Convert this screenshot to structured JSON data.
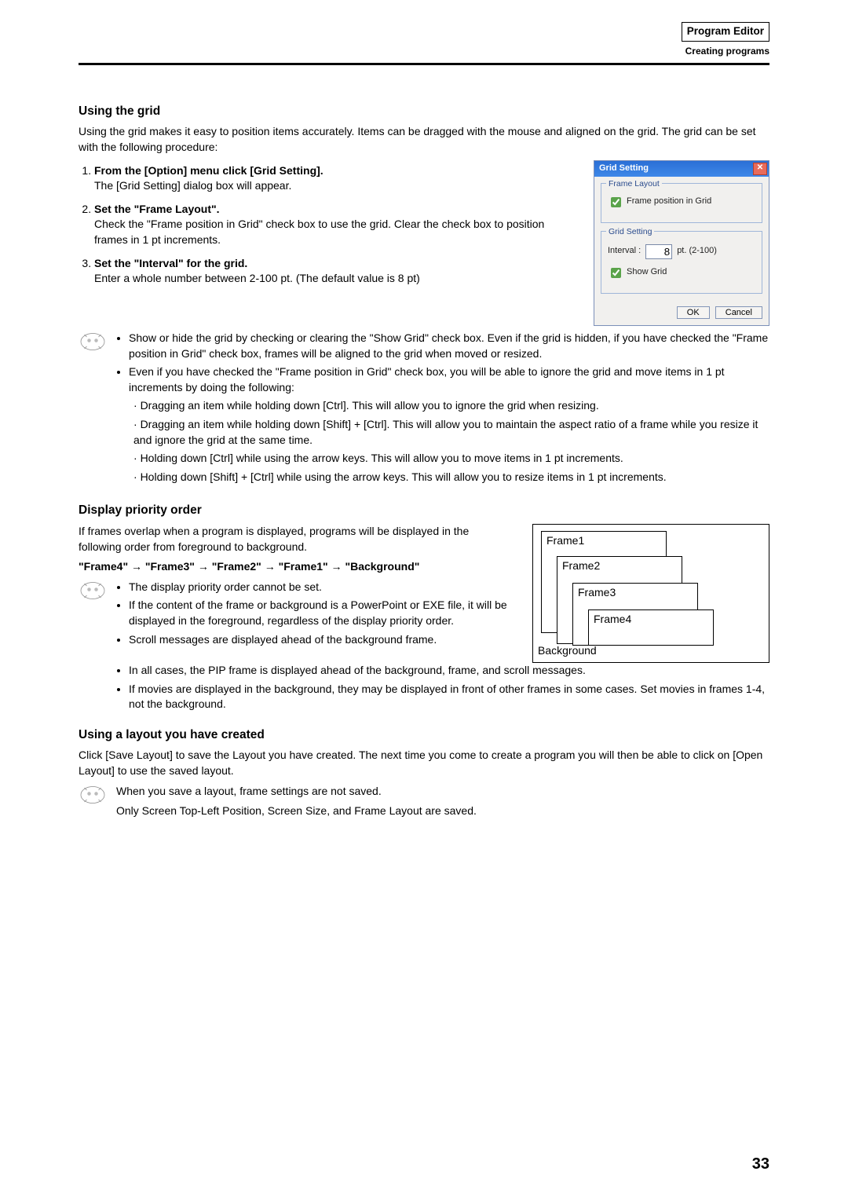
{
  "header": {
    "title": "Program Editor",
    "subtitle": "Creating programs"
  },
  "section1": {
    "heading": "Using the grid",
    "intro": "Using the grid makes it easy to position items accurately. Items can be dragged with the mouse and aligned on the grid. The grid can be set with the following procedure:",
    "steps": [
      {
        "title": "From the [Option] menu click [Grid Setting].",
        "body": "The [Grid Setting] dialog box will appear."
      },
      {
        "title": "Set the \"Frame Layout\".",
        "body": "Check the \"Frame position in Grid\" check box to use the grid. Clear the check box to position frames in 1 pt increments."
      },
      {
        "title": "Set the \"Interval\" for the grid.",
        "body": "Enter a whole number between 2-100 pt. (The default value is 8 pt)"
      }
    ],
    "dialog": {
      "title": "Grid Setting",
      "legend1": "Frame Layout",
      "chk_frame_pos": "Frame position in Grid",
      "legend2": "Grid Setting",
      "interval_label": "Interval :",
      "interval_value": "8",
      "interval_unit": "pt. (2-100)",
      "chk_show_grid": "Show Grid",
      "ok": "OK",
      "cancel": "Cancel"
    },
    "notes": [
      "Show or hide the grid by checking or clearing the \"Show Grid\" check box. Even if the grid is hidden, if you have checked the \"Frame position in Grid\" check box, frames will be aligned to the grid when moved or resized.",
      "Even if you have checked the \"Frame position in Grid\" check box, you will be able to ignore the grid and move items in 1 pt increments by doing the following:"
    ],
    "subnotes": [
      "Dragging an item while holding down [Ctrl]. This will allow you to ignore the grid when resizing.",
      "Dragging an item while holding down [Shift] + [Ctrl]. This will allow you to maintain the aspect ratio of a frame while you resize it and ignore the grid at the same time.",
      "Holding down [Ctrl] while using the arrow keys. This will allow you to move items in 1 pt increments.",
      "Holding down [Shift] + [Ctrl] while using the arrow keys. This will allow you to resize items in 1 pt increments."
    ]
  },
  "section2": {
    "heading": "Display priority order",
    "intro": "If frames overlap when a program is displayed, programs will be displayed in the following order from foreground to background.",
    "order": "\"Frame4\" → \"Frame3\" → \"Frame2\" → \"Frame1\" → \"Background\"",
    "diagram": {
      "f1": "Frame1",
      "f2": "Frame2",
      "f3": "Frame3",
      "f4": "Frame4",
      "bg": "Background"
    },
    "notes": [
      "The display priority order cannot be set.",
      "If the content of the frame or background is a PowerPoint or EXE file, it will be displayed in the foreground, regardless of the display priority order.",
      "Scroll messages are displayed ahead of the background frame.",
      "In all cases, the PIP frame is displayed ahead of the background, frame, and scroll messages.",
      "If movies are displayed in the background, they may be displayed in front of other frames in some cases. Set movies in frames 1-4, not the background."
    ]
  },
  "section3": {
    "heading": "Using a layout you have created",
    "body": "Click [Save Layout] to save the Layout you have created. The next time you come to create a program you will then be able to click on [Open Layout] to use the saved layout.",
    "note1": "When you save a layout, frame settings are not saved.",
    "note2": "Only Screen Top-Left Position, Screen Size, and Frame Layout are saved."
  },
  "page_number": "33"
}
